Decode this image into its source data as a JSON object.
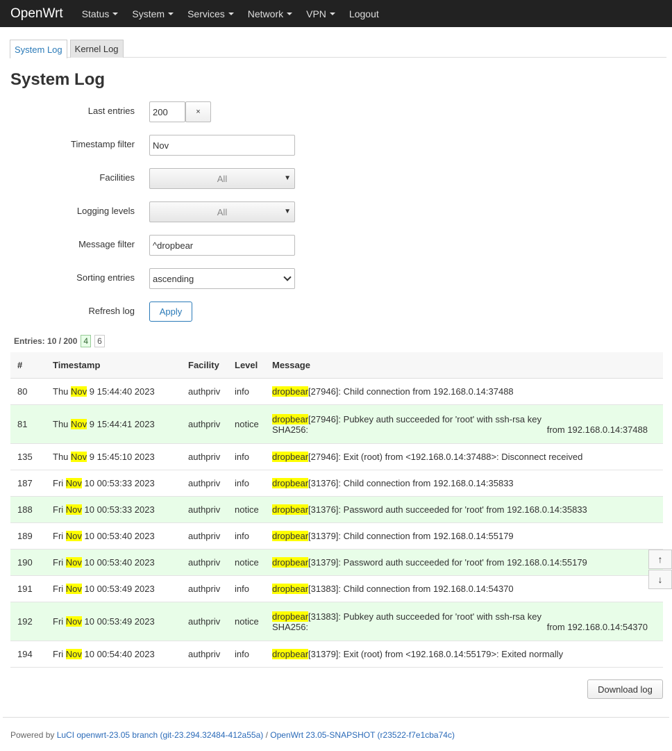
{
  "header": {
    "brand": "OpenWrt",
    "menu": [
      "Status",
      "System",
      "Services",
      "Network",
      "VPN",
      "Logout"
    ]
  },
  "tabs": [
    "System Log",
    "Kernel Log"
  ],
  "page_title": "System Log",
  "form": {
    "last_entries": {
      "label": "Last entries",
      "value": "200",
      "clear": "×"
    },
    "timestamp_filter": {
      "label": "Timestamp filter",
      "value": "Nov"
    },
    "facilities": {
      "label": "Facilities",
      "value": "All"
    },
    "logging_levels": {
      "label": "Logging levels",
      "value": "All"
    },
    "message_filter": {
      "label": "Message filter",
      "value": "^dropbear"
    },
    "sorting": {
      "label": "Sorting entries",
      "value": "ascending"
    },
    "refresh": {
      "label": "Refresh log",
      "button": "Apply"
    }
  },
  "entries": {
    "prefix": "Entries:",
    "count": "10 / 200",
    "badge1": "4",
    "badge2": "6"
  },
  "table": {
    "headers": [
      "#",
      "Timestamp",
      "Facility",
      "Level",
      "Message"
    ],
    "rows": [
      {
        "num": "80",
        "ts_pre": "Thu ",
        "ts_hl": "Nov",
        "ts_post": " 9 15:44:40 2023",
        "facility": "authpriv",
        "level": "info",
        "msg_hl": "dropbear",
        "msg": "[27946]: Child connection from 192.168.0.14:37488"
      },
      {
        "num": "81",
        "ts_pre": "Thu ",
        "ts_hl": "Nov",
        "ts_post": " 9 15:44:41 2023",
        "facility": "authpriv",
        "level": "notice",
        "msg_hl": "dropbear",
        "msg": "[27946]: Pubkey auth succeeded for 'root' with ssh-rsa key",
        "msg2a": "SHA256:",
        "msg2b": "from 192.168.0.14:37488"
      },
      {
        "num": "135",
        "ts_pre": "Thu ",
        "ts_hl": "Nov",
        "ts_post": " 9 15:45:10 2023",
        "facility": "authpriv",
        "level": "info",
        "msg_hl": "dropbear",
        "msg": "[27946]: Exit (root) from <192.168.0.14:37488>: Disconnect received"
      },
      {
        "num": "187",
        "ts_pre": "Fri ",
        "ts_hl": "Nov",
        "ts_post": " 10 00:53:33 2023",
        "facility": "authpriv",
        "level": "info",
        "msg_hl": "dropbear",
        "msg": "[31376]: Child connection from 192.168.0.14:35833"
      },
      {
        "num": "188",
        "ts_pre": "Fri ",
        "ts_hl": "Nov",
        "ts_post": " 10 00:53:33 2023",
        "facility": "authpriv",
        "level": "notice",
        "msg_hl": "dropbear",
        "msg": "[31376]: Password auth succeeded for 'root' from 192.168.0.14:35833"
      },
      {
        "num": "189",
        "ts_pre": "Fri ",
        "ts_hl": "Nov",
        "ts_post": " 10 00:53:40 2023",
        "facility": "authpriv",
        "level": "info",
        "msg_hl": "dropbear",
        "msg": "[31379]: Child connection from 192.168.0.14:55179"
      },
      {
        "num": "190",
        "ts_pre": "Fri ",
        "ts_hl": "Nov",
        "ts_post": " 10 00:53:40 2023",
        "facility": "authpriv",
        "level": "notice",
        "msg_hl": "dropbear",
        "msg": "[31379]: Password auth succeeded for 'root' from 192.168.0.14:55179"
      },
      {
        "num": "191",
        "ts_pre": "Fri ",
        "ts_hl": "Nov",
        "ts_post": " 10 00:53:49 2023",
        "facility": "authpriv",
        "level": "info",
        "msg_hl": "dropbear",
        "msg": "[31383]: Child connection from 192.168.0.14:54370"
      },
      {
        "num": "192",
        "ts_pre": "Fri ",
        "ts_hl": "Nov",
        "ts_post": " 10 00:53:49 2023",
        "facility": "authpriv",
        "level": "notice",
        "msg_hl": "dropbear",
        "msg": "[31383]: Pubkey auth succeeded for 'root' with ssh-rsa key",
        "msg2a": "SHA256:",
        "msg2b": "from 192.168.0.14:54370"
      },
      {
        "num": "194",
        "ts_pre": "Fri ",
        "ts_hl": "Nov",
        "ts_post": " 10 00:54:40 2023",
        "facility": "authpriv",
        "level": "info",
        "msg_hl": "dropbear",
        "msg": "[31379]: Exit (root) from <192.168.0.14:55179>: Exited normally"
      }
    ]
  },
  "scroll": {
    "up": "↑",
    "down": "↓"
  },
  "download": "Download log",
  "footer": {
    "prefix": "Powered by ",
    "luci": "LuCI openwrt-23.05 branch (git-23.294.32484-412a55a)",
    "sep": " / ",
    "openwrt": "OpenWrt 23.05-SNAPSHOT (r23522-f7e1cba74c)"
  }
}
